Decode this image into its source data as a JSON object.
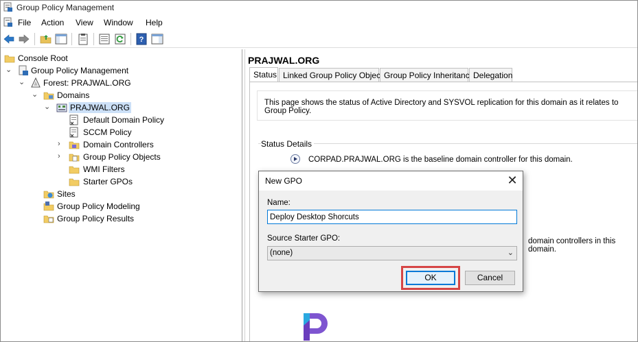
{
  "window": {
    "title": "Group Policy Management"
  },
  "menubar": {
    "items": [
      "File",
      "Action",
      "View",
      "Window",
      "Help"
    ]
  },
  "tree": {
    "items": [
      {
        "label": "Console Root",
        "icon": "folder-icon"
      },
      {
        "label": "Group Policy Management",
        "icon": "gpm-icon"
      },
      {
        "label": "Forest: PRAJWAL.ORG",
        "icon": "forest-icon"
      },
      {
        "label": "Domains",
        "icon": "domains-folder-icon"
      },
      {
        "label": "PRAJWAL.ORG",
        "icon": "domain-icon",
        "selected": true
      },
      {
        "label": "Default Domain Policy",
        "icon": "gpo-link-icon"
      },
      {
        "label": "SCCM Policy",
        "icon": "gpo-link-icon"
      },
      {
        "label": "Domain Controllers",
        "icon": "ou-icon"
      },
      {
        "label": "Group Policy Objects",
        "icon": "gpo-folder-icon"
      },
      {
        "label": "WMI Filters",
        "icon": "wmi-folder-icon"
      },
      {
        "label": "Starter GPOs",
        "icon": "starter-folder-icon"
      },
      {
        "label": "Sites",
        "icon": "sites-icon"
      },
      {
        "label": "Group Policy Modeling",
        "icon": "modeling-icon"
      },
      {
        "label": "Group Policy Results",
        "icon": "results-icon"
      }
    ]
  },
  "main": {
    "title": "PRAJWAL.ORG",
    "tabs": [
      "Status",
      "Linked Group Policy Objects",
      "Group Policy Inheritance",
      "Delegation"
    ],
    "active_tab": "Status",
    "info_text": "This page shows the status of Active Directory and SYSVOL replication for this domain as it relates to Group Policy.",
    "status_details_label": "Status Details",
    "baseline_text": "CORPAD.PRAJWAL.ORG is the baseline domain controller for this domain.",
    "partial_text": "domain controllers in this domain."
  },
  "dialog": {
    "title": "New GPO",
    "name_label": "Name:",
    "name_value": "Deploy Desktop Shorcuts",
    "source_label": "Source Starter GPO:",
    "source_value": "(none)",
    "ok_label": "OK",
    "cancel_label": "Cancel"
  },
  "colors": {
    "accent": "#0078d7",
    "highlight": "#d64545",
    "selection": "#cce0f7"
  }
}
